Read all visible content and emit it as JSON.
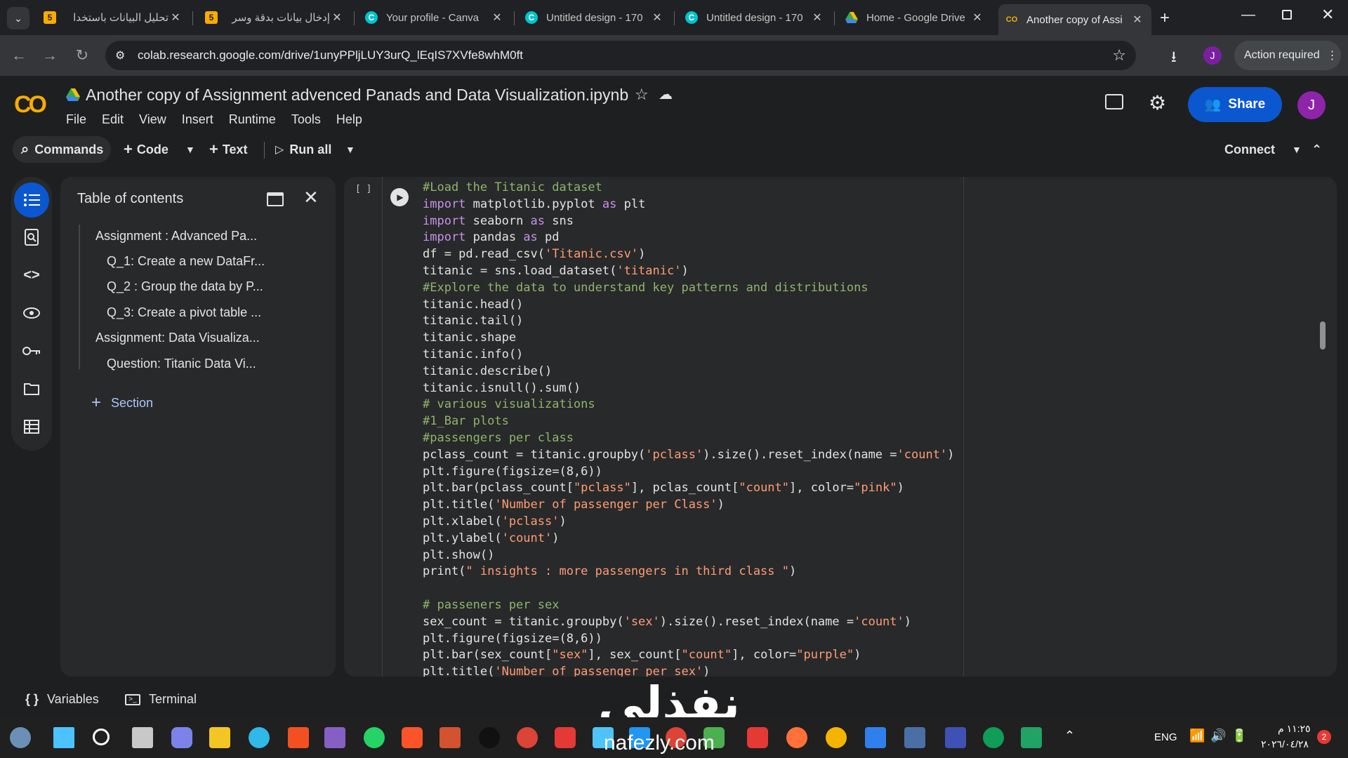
{
  "browser": {
    "tabs": [
      {
        "label": "تحليل البيانات باستخدا",
        "favicon": "5",
        "favicon_color": "#f9ab00",
        "active": false
      },
      {
        "label": "إدخال بيانات بدقة وسر",
        "favicon": "5",
        "favicon_color": "#f9ab00",
        "active": false
      },
      {
        "label": "Your profile - Canva",
        "favicon": "C",
        "favicon_color": "#00c4cc",
        "active": false
      },
      {
        "label": "Untitled design - 170",
        "favicon": "C",
        "favicon_color": "#00c4cc",
        "active": false
      },
      {
        "label": "Untitled design - 170",
        "favicon": "C",
        "favicon_color": "#00c4cc",
        "active": false
      },
      {
        "label": "Home - Google Drive",
        "favicon": "drive",
        "favicon_color": "#34a853",
        "active": false
      },
      {
        "label": "Another copy of Assi",
        "favicon": "co",
        "favicon_color": "#f9ab00",
        "active": true
      }
    ],
    "url": "colab.research.google.com/drive/1unyPPljLUY3urQ_lEqIS7XVfe8whM0ft",
    "action_required": "Action required",
    "profile_initial": "J"
  },
  "colab": {
    "title": "Another copy of Assignment advenced Panads and Data Visualization.ipynb",
    "menu": [
      "File",
      "Edit",
      "View",
      "Insert",
      "Runtime",
      "Tools",
      "Help"
    ],
    "share_label": "Share",
    "avatar_initial": "J",
    "toolbar": {
      "commands": "Commands",
      "code": "Code",
      "text": "Text",
      "run_all": "Run all",
      "connect": "Connect"
    }
  },
  "toc": {
    "title": "Table of contents",
    "items": [
      {
        "label": "Assignment : Advanced Pa...",
        "level": 1
      },
      {
        "label": "Q_1: Create a new DataFr...",
        "level": 2
      },
      {
        "label": "Q_2 : Group the data by P...",
        "level": 2
      },
      {
        "label": "Q_3: Create a pivot table ...",
        "level": 2
      },
      {
        "label": "Assignment: Data Visualiza...",
        "level": 1
      },
      {
        "label": "Question: Titanic Data Vi...",
        "level": 2
      }
    ],
    "add_section": "Section"
  },
  "cell": {
    "exec_count": "[ ]",
    "lines": [
      [
        [
          "cm",
          "#Load the Titanic dataset"
        ]
      ],
      [
        [
          "kw",
          "import"
        ],
        [
          "fn",
          " matplotlib.pyplot "
        ],
        [
          "kw",
          "as"
        ],
        [
          "fn",
          " plt"
        ]
      ],
      [
        [
          "kw",
          "import"
        ],
        [
          "fn",
          " seaborn "
        ],
        [
          "kw",
          "as"
        ],
        [
          "fn",
          " sns"
        ]
      ],
      [
        [
          "kw",
          "import"
        ],
        [
          "fn",
          " pandas "
        ],
        [
          "kw",
          "as"
        ],
        [
          "fn",
          " pd"
        ]
      ],
      [
        [
          "fn",
          "df = pd.read_csv("
        ],
        [
          "str",
          "'Titanic.csv'"
        ],
        [
          "fn",
          ")"
        ]
      ],
      [
        [
          "fn",
          "titanic = sns.load_dataset("
        ],
        [
          "str",
          "'titanic'"
        ],
        [
          "fn",
          ")"
        ]
      ],
      [
        [
          "cm",
          "#Explore the data to understand key patterns and distributions"
        ]
      ],
      [
        [
          "fn",
          "titanic.head()"
        ]
      ],
      [
        [
          "fn",
          "titanic.tail()"
        ]
      ],
      [
        [
          "fn",
          "titanic.shape"
        ]
      ],
      [
        [
          "fn",
          "titanic.info()"
        ]
      ],
      [
        [
          "fn",
          "titanic.describe()"
        ]
      ],
      [
        [
          "fn",
          "titanic.isnull().sum()"
        ]
      ],
      [
        [
          "cm",
          "# various visualizations"
        ]
      ],
      [
        [
          "cm",
          "#1_Bar plots"
        ]
      ],
      [
        [
          "cm",
          "#passengers per class"
        ]
      ],
      [
        [
          "fn",
          "pclass_count = titanic.groupby("
        ],
        [
          "str",
          "'pclass'"
        ],
        [
          "fn",
          ").size().reset_index(name ="
        ],
        [
          "str",
          "'count'"
        ],
        [
          "fn",
          ")"
        ]
      ],
      [
        [
          "fn",
          "plt.figure(figsize=(8,6))"
        ]
      ],
      [
        [
          "fn",
          "plt.bar(pclass_count["
        ],
        [
          "str",
          "\"pclass\""
        ],
        [
          "fn",
          "], pclas_count["
        ],
        [
          "str",
          "\"count\""
        ],
        [
          "fn",
          "], color="
        ],
        [
          "str",
          "\"pink\""
        ],
        [
          "fn",
          ")"
        ]
      ],
      [
        [
          "fn",
          "plt.title("
        ],
        [
          "str",
          "'Number of passenger per Class'"
        ],
        [
          "fn",
          ")"
        ]
      ],
      [
        [
          "fn",
          "plt.xlabel("
        ],
        [
          "str",
          "'pclass'"
        ],
        [
          "fn",
          ")"
        ]
      ],
      [
        [
          "fn",
          "plt.ylabel("
        ],
        [
          "str",
          "'count'"
        ],
        [
          "fn",
          ")"
        ]
      ],
      [
        [
          "fn",
          "plt.show()"
        ]
      ],
      [
        [
          "fn",
          "print("
        ],
        [
          "str",
          "\" insights : more passengers in third class \""
        ],
        [
          "fn",
          ")"
        ]
      ],
      [
        [
          "fn",
          ""
        ]
      ],
      [
        [
          "cm",
          "# passeners per sex"
        ]
      ],
      [
        [
          "fn",
          "sex_count = titanic.groupby("
        ],
        [
          "str",
          "'sex'"
        ],
        [
          "fn",
          ").size().reset_index(name ="
        ],
        [
          "str",
          "'count'"
        ],
        [
          "fn",
          ")"
        ]
      ],
      [
        [
          "fn",
          "plt.figure(figsize=(8,6))"
        ]
      ],
      [
        [
          "fn",
          "plt.bar(sex_count["
        ],
        [
          "str",
          "\"sex\""
        ],
        [
          "fn",
          "], sex_count["
        ],
        [
          "str",
          "\"count\""
        ],
        [
          "fn",
          "], color="
        ],
        [
          "str",
          "\"purple\""
        ],
        [
          "fn",
          ")"
        ]
      ],
      [
        [
          "fn",
          "plt.title("
        ],
        [
          "str",
          "'Number of passenger per sex'"
        ],
        [
          "fn",
          ")"
        ]
      ]
    ]
  },
  "bottom": {
    "variables": "Variables",
    "terminal": "Terminal"
  },
  "watermark": {
    "arabic": "نفذلي",
    "latin": "nafezly.com"
  },
  "taskbar": {
    "lang": "ENG",
    "time": "١١:٢٥ م",
    "date": "٢٠٢٦/٠٤/٢٨",
    "notif_count": "2"
  }
}
